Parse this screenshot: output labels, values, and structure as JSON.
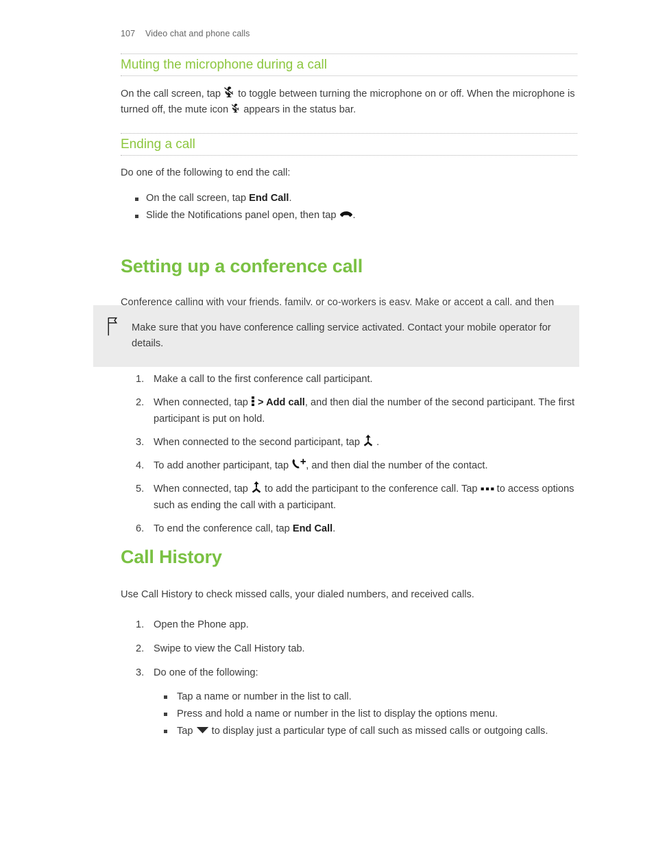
{
  "header": {
    "page_number": "107",
    "chapter": "Video chat and phone calls"
  },
  "sections": {
    "muting": {
      "heading": "Muting the microphone during a call",
      "paragraph_part1": "On the call screen, tap",
      "paragraph_part2": "to toggle between turning the microphone on or off. When the microphone is turned off, the mute icon",
      "paragraph_part3": "appears in the status bar.",
      "icon_mute": "mute-microphone-icon"
    },
    "ending": {
      "heading": "Ending a call",
      "intro": "Do one of the following to end the call:",
      "bullets": [
        {
          "text_before": "On the call screen, tap",
          "bold": "End Call",
          "text_after": "."
        },
        {
          "text_before": "Slide the Notifications panel open, then tap",
          "bold": "",
          "text_after": "."
        }
      ],
      "icon_end_call": "end-call-icon"
    },
    "conference": {
      "heading": "Setting up a conference call",
      "intro": "Conference calling with your friends, family, or co-workers is easy. Make or accept a call, and then simply dial each subsequent call to add it to the conference.",
      "note": "Make sure that you have conference calling service activated. Contact your mobile operator for details.",
      "note_icon": "flag-icon",
      "steps": [
        {
          "id": "step-1",
          "text_a": "Make a call to the first conference call participant.",
          "text_b": "",
          "text_c": ""
        },
        {
          "id": "step-2",
          "text_a": "When connected, tap",
          "bold_a": "> Add call",
          "text_b": ", and then dial the number of the second participant. The first participant is put on hold.",
          "icon": "overflow-menu-icon"
        },
        {
          "id": "step-3",
          "text_a": "When connected to the second participant, tap",
          "text_b": ".",
          "icon": "merge-call-icon"
        },
        {
          "id": "step-4",
          "text_a": "To add another participant, tap",
          "text_b": ", and then dial the number of the contact.",
          "icon": "add-call-icon"
        },
        {
          "id": "step-5",
          "text_a": "When connected, tap",
          "text_b": "to add the participant to the conference call. Tap",
          "text_c": "to access options such as ending the call with a participant.",
          "icon": "merge-call-icon",
          "icon2": "more-options-icon"
        },
        {
          "id": "step-6",
          "text_a": "To end the conference call, tap",
          "bold_a": "End Call",
          "text_b": "."
        }
      ]
    },
    "call_history": {
      "heading": "Call History",
      "intro": "Use Call History to check missed calls, your dialed numbers, and received calls.",
      "steps": [
        {
          "id": "ch-step-1",
          "text_a": "Open the Phone app."
        },
        {
          "id": "ch-step-2",
          "text_a": "Swipe to view the Call History tab."
        },
        {
          "id": "ch-step-3",
          "text_a": "Do one of the following:"
        }
      ],
      "sub_bullets": [
        {
          "text_a": "Tap a name or number in the list to call.",
          "text_b": ""
        },
        {
          "text_a": "Press and hold a name or number in the list to display the options menu.",
          "text_b": ""
        },
        {
          "text_a": "Tap",
          "text_b": "to display just a particular type of call such as missed calls or outgoing calls.",
          "icon": "dropdown-triangle-icon"
        }
      ]
    }
  },
  "colors": {
    "heading_green": "#7ac143",
    "subheading_green": "#8cc63e",
    "body_text": "#3f3f3f",
    "note_background": "#ebebeb"
  }
}
